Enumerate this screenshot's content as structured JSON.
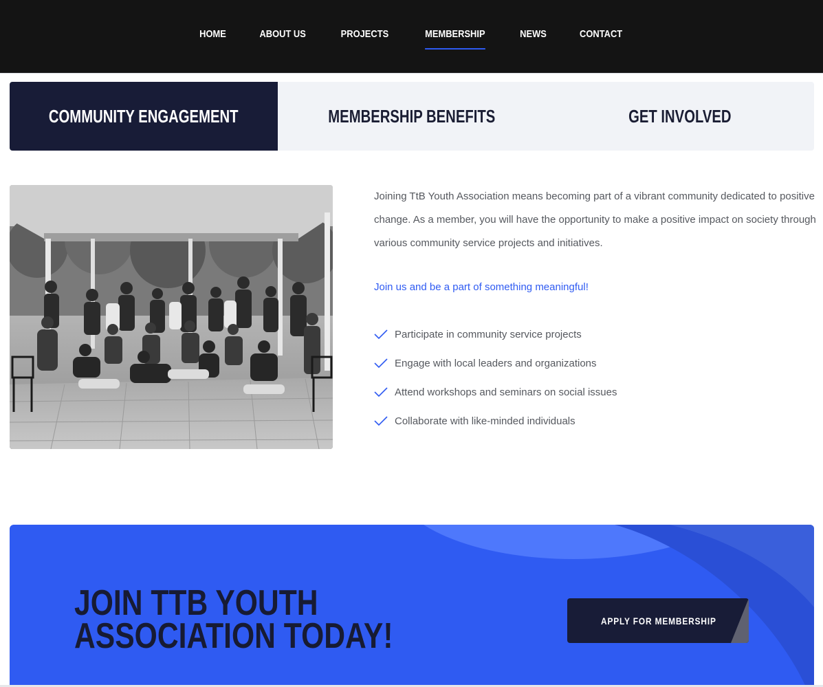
{
  "nav": {
    "items": [
      {
        "label": "HOME"
      },
      {
        "label": "ABOUT US"
      },
      {
        "label": "PROJECTS"
      },
      {
        "label": "MEMBERSHIP"
      },
      {
        "label": "NEWS"
      },
      {
        "label": "CONTACT"
      }
    ],
    "active": "MEMBERSHIP"
  },
  "tabs": [
    {
      "label": "COMMUNITY ENGAGEMENT",
      "active": true
    },
    {
      "label": "MEMBERSHIP BENEFITS",
      "active": false
    },
    {
      "label": "GET INVOLVED",
      "active": false
    }
  ],
  "content": {
    "paragraph": "Joining TtB Youth Association means becoming part of a vibrant community dedicated to positive change. As a member, you will have the opportunity to make a positive impact on society through various community service projects and initiatives.",
    "highlight": "Join us and be a part of something meaningful!",
    "benefits": [
      "Participate in community service projects",
      "Engage with local leaders and organizations",
      "Attend workshops and seminars on social issues",
      "Collaborate with like-minded individuals"
    ],
    "photo_icon": "group-photo"
  },
  "cta": {
    "title": "JOIN TTB YOUTH ASSOCIATION TODAY!",
    "button_label": "APPLY FOR MEMBERSHIP"
  },
  "colors": {
    "nav_bg": "#141414",
    "accent": "#2f5bf2",
    "dark_navy": "#181c37",
    "tab_bg": "#f1f3f7",
    "text": "#55585e"
  }
}
